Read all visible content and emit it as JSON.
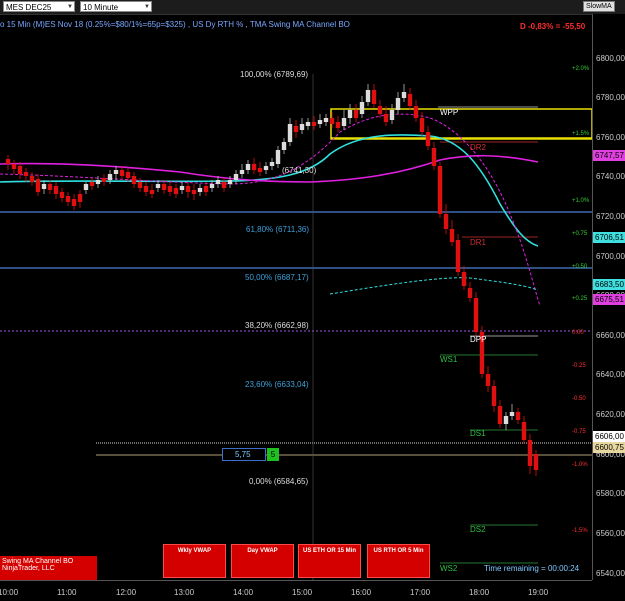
{
  "toolbar": {
    "instrument": "MES DEC25",
    "interval": "10 Minute",
    "indicator_button": "SlowMA"
  },
  "chart": {
    "title": "o 15 Min (M)ES Nov 18 (0.25%=$80/1%=65p=$325) , US Dy RTH % , TMA Swing MA Channel BO",
    "pnl": "D -0,83% = -55,50"
  },
  "price_axis": [
    "6800,00",
    "6780,00",
    "6760,00",
    "6740,00",
    "6720,00",
    "6700,00",
    "6680,00",
    "6660,00",
    "6640,00",
    "6620,00",
    "6600,00",
    "6580,00",
    "6560,00",
    "6540,00"
  ],
  "price_tags": [
    {
      "label": "6747,57",
      "color": "#e040e0"
    },
    {
      "label": "6706,51",
      "color": "#40e0e0"
    },
    {
      "label": "6683,50",
      "color": "#40e0e0"
    },
    {
      "label": "6675,51",
      "color": "#e040e0"
    },
    {
      "label": "6606,00",
      "color": "#ffffff"
    },
    {
      "label": "6600,75",
      "color": "#e8d8a0"
    }
  ],
  "time_axis": [
    "10:00",
    "11:00",
    "12:00",
    "13:00",
    "14:00",
    "15:00",
    "16:00",
    "17:00",
    "18:00",
    "19:00"
  ],
  "fib_levels": [
    {
      "label": "100,00% (6789,69)",
      "color": "#dddddd"
    },
    {
      "label": "(6741,30)",
      "color": "#dddddd"
    },
    {
      "label": "61,80% (6711,36)",
      "color": "#3fa0d8"
    },
    {
      "label": "50,00% (6687,17)",
      "color": "#3fa0d8"
    },
    {
      "label": "38,20% (6662,98)",
      "color": "#dddddd"
    },
    {
      "label": "23,60% (6633,04)",
      "color": "#3fa0d8"
    },
    {
      "label": "0,00% (6584,65)",
      "color": "#dddddd"
    }
  ],
  "level_labels": [
    {
      "label": "WPP",
      "color": "#ffffff"
    },
    {
      "label": "DR2",
      "color": "#d03030"
    },
    {
      "label": "DR1",
      "color": "#d03030"
    },
    {
      "label": "DPP",
      "color": "#ffffff"
    },
    {
      "label": "WS1",
      "color": "#30c040"
    },
    {
      "label": "DS1",
      "color": "#30c040"
    },
    {
      "label": "DS2",
      "color": "#30c040"
    },
    {
      "label": "WS2",
      "color": "#30c040"
    }
  ],
  "pct_labels": [
    {
      "label": "+2.0%",
      "color": "#30d030"
    },
    {
      "label": "+1.5%",
      "color": "#30d030"
    },
    {
      "label": "+1.0%",
      "color": "#30d030"
    },
    {
      "label": "+0.75",
      "color": "#30d030"
    },
    {
      "label": "+0.50",
      "color": "#30d030"
    },
    {
      "label": "+0.25",
      "color": "#30d030"
    },
    {
      "label": "0.00",
      "color": "#ff3030"
    },
    {
      "label": "-0.25",
      "color": "#ff3030"
    },
    {
      "label": "-0.50",
      "color": "#ff3030"
    },
    {
      "label": "-0.75",
      "color": "#ff3030"
    },
    {
      "label": "-1.0%",
      "color": "#ff3030"
    },
    {
      "label": "-1.5%",
      "color": "#ff3030"
    }
  ],
  "order": {
    "quantity": "5,75",
    "button": "5"
  },
  "buttons": {
    "wkly_vwap": "Wkly VWAP",
    "day_vwap": "Day VWAP",
    "us_eth": "US ETH OR 15 Min",
    "us_rth": "US RTH OR 5 Min"
  },
  "legend": {
    "line1": "Swing MA Channel BO",
    "line2": "NinjaTrader, LLC"
  },
  "status": {
    "time_remaining": "Time remaining = 00:00:24"
  }
}
